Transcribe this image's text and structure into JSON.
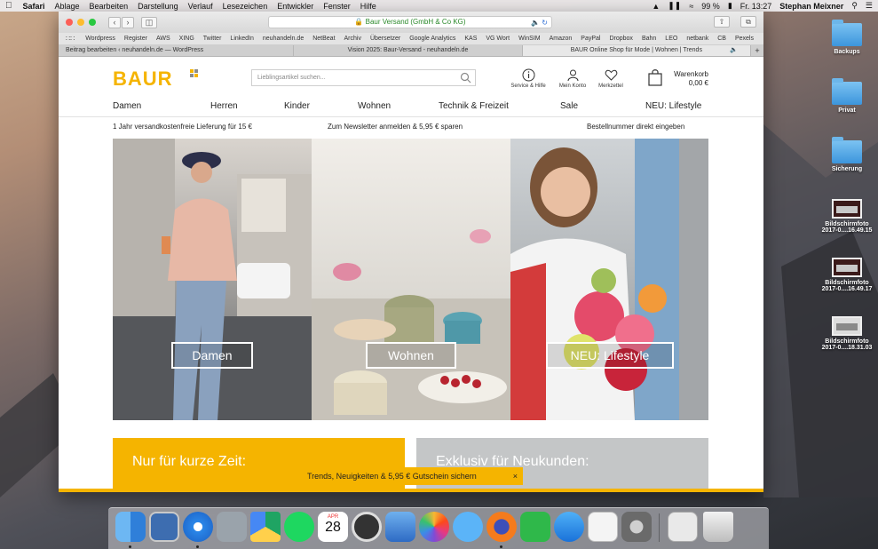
{
  "menubar": {
    "app": "Safari",
    "items": [
      "Ablage",
      "Bearbeiten",
      "Darstellung",
      "Verlauf",
      "Lesezeichen",
      "Entwickler",
      "Fenster",
      "Hilfe"
    ],
    "battery": "99 %",
    "clock": "Fr. 13:27",
    "user": "Stephan Meixner"
  },
  "browser": {
    "url": "Baur Versand (GmbH & Co KG)",
    "bookmarks": [
      "Wordpress",
      "Register",
      "AWS",
      "XING",
      "Twitter",
      "LinkedIn",
      "neuhandeln.de",
      "NetBeat",
      "Archiv",
      "Übersetzer",
      "Google Analytics",
      "KAS",
      "VG Wort",
      "WinSIM",
      "Amazon",
      "PayPal",
      "Dropbox",
      "Bahn",
      "LEO",
      "netbank",
      "CB",
      "Pexels"
    ],
    "tabs": [
      "Beitrag bearbeiten ‹ neuhandeln.de — WordPress",
      "Vision 2025: Baur-Versand - neuhandeln.de",
      "BAUR Online Shop für Mode | Wohnen | Trends"
    ]
  },
  "site": {
    "logo": "BAUR",
    "search_placeholder": "Lieblingsartikel suchen...",
    "icons": {
      "service": "Service & Hilfe",
      "account": "Mein Konto",
      "wishlist": "Merkzettel"
    },
    "cart": {
      "label": "Warenkorb",
      "amount": "0,00 €"
    },
    "nav": [
      "Damen",
      "Herren",
      "Kinder",
      "Wohnen",
      "Technik & Freizeit",
      "Sale",
      "NEU: Lifestyle"
    ],
    "promos": [
      "1 Jahr versandkostenfreie Lieferung für 15 €",
      "Zum Newsletter anmelden & 5,95 € sparen",
      "Bestellnummer direkt eingeben"
    ],
    "hero": [
      "Damen",
      "Wohnen",
      "NEU: Lifestyle"
    ],
    "tiles": [
      "Nur für kurze Zeit:",
      "Exklusiv für Neukunden:"
    ],
    "banner": "Trends, Neuigkeiten & 5,95 € Gutschein sichern",
    "banner_close": "×"
  },
  "desktop": [
    {
      "label": "Backups",
      "type": "folder"
    },
    {
      "label": "Privat",
      "type": "folder"
    },
    {
      "label": "Sicherung",
      "type": "folder"
    },
    {
      "label": "Bildschirmfoto 2017-0....16.49.15",
      "type": "screenshot"
    },
    {
      "label": "Bildschirmfoto 2017-0....16.49.17",
      "type": "screenshot"
    },
    {
      "label": "Bildschirmfoto 2017-0....18.31.03",
      "type": "screenshot"
    }
  ],
  "dock": {
    "calendar_month": "APR",
    "calendar_day": "28"
  },
  "colors": {
    "brand_yellow": "#f5b400",
    "tile_gray": "#c4c6c7"
  }
}
